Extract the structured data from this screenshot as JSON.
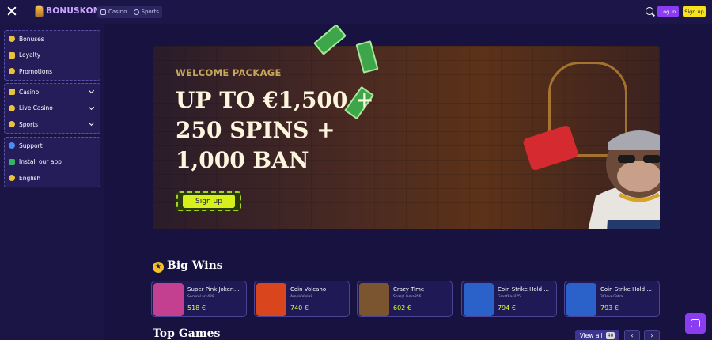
{
  "header": {
    "logo_text": "BONUSKONG",
    "tabs": [
      {
        "label": "Casino",
        "icon": "dice-icon"
      },
      {
        "label": "Sports",
        "icon": "ball-icon"
      }
    ],
    "login_label": "Log in",
    "signup_label": "Sign up"
  },
  "sidebar": {
    "groups": [
      [
        {
          "label": "Bonuses",
          "icon": "bonus-icon"
        },
        {
          "label": "Loyalty",
          "icon": "crown-icon"
        },
        {
          "label": "Promotions",
          "icon": "promo-icon"
        }
      ],
      [
        {
          "label": "Casino",
          "icon": "casino-icon"
        },
        {
          "label": "Live Casino",
          "icon": "live-icon"
        },
        {
          "label": "Sports",
          "icon": "ball-icon"
        }
      ],
      [
        {
          "label": "Support",
          "icon": "support-icon"
        },
        {
          "label": "Install our app",
          "icon": "android-icon"
        },
        {
          "label": "English",
          "icon": "globe-icon"
        }
      ]
    ]
  },
  "hero": {
    "subtitle": "WELCOME PACKAGE",
    "title": "UP TO €1,500 + 250 SPINS + 1,000 BAN",
    "cta_label": "Sign up"
  },
  "big_wins": {
    "title": "Big Wins",
    "items": [
      {
        "game": "Super Pink Joker:...",
        "user": "SecureLark428",
        "amount": "518 €",
        "thumb": "#c2408f"
      },
      {
        "game": "Coin Volcano",
        "user": "AmpleViola8",
        "amount": "740 €",
        "thumb": "#d9451d"
      },
      {
        "game": "Crazy Time",
        "user": "SharpLlama856",
        "amount": "602 €",
        "thumb": "#7b5530"
      },
      {
        "game": "Coin Strike Hold ...",
        "user": "GreatBasil75",
        "amount": "794 €",
        "thumb": "#2a62c9"
      },
      {
        "game": "Coin Strike Hold ...",
        "user": "3CleverTetra",
        "amount": "793 €",
        "thumb": "#2a62c9"
      }
    ]
  },
  "top_games": {
    "title": "Top Games",
    "view_all_label": "View all",
    "count": "40"
  }
}
